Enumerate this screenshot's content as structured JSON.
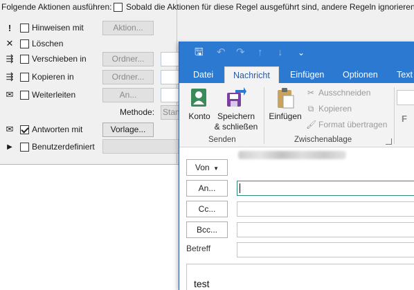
{
  "rules": {
    "header": "Folgende Aktionen ausführen:",
    "stop_rule_label": "Sobald die Aktionen für diese Regel ausgeführt sind, andere Regeln ignorieren",
    "actions": [
      {
        "label": "Hinweisen mit",
        "icon": "!",
        "checked": false,
        "button": "Aktion..."
      },
      {
        "label": "Löschen",
        "icon": "✕",
        "checked": false
      },
      {
        "label": "Verschieben in",
        "icon": "⇶",
        "checked": false,
        "button": "Ordner..."
      },
      {
        "label": "Kopieren in",
        "icon": "⇶",
        "checked": false,
        "button": "Ordner..."
      },
      {
        "label": "Weiterleiten",
        "icon": "✉",
        "checked": false,
        "button": "An..."
      },
      {
        "label": "Antworten mit",
        "icon": "✉",
        "checked": true,
        "button": "Vorlage..."
      },
      {
        "label": "Benutzerdefiniert",
        "icon": "▶",
        "checked": false
      }
    ],
    "methode_label": "Methode:",
    "methode_value": "Stan"
  },
  "outlook": {
    "qat": {
      "save": "🖫",
      "undo": "↶",
      "redo": "↷",
      "up": "↑",
      "down": "↓",
      "more": "⌄"
    },
    "tabs": [
      "Datei",
      "Nachricht",
      "Einfügen",
      "Optionen",
      "Text f"
    ],
    "active_tab": "Nachricht",
    "ribbon": {
      "konto": "Konto",
      "save_close_1": "Speichern",
      "save_close_2": "& schließen",
      "group_senden": "Senden",
      "paste": "Einfügen",
      "cut": "Ausschneiden",
      "copy": "Kopieren",
      "format_painter": "Format übertragen",
      "group_clipboard": "Zwischenablage",
      "font_letter": "F"
    },
    "compose": {
      "from_button": "Von",
      "to_button": "An...",
      "cc_button": "Cc...",
      "bcc_button": "Bcc...",
      "subject_label": "Betreff",
      "body_text": "test"
    }
  }
}
